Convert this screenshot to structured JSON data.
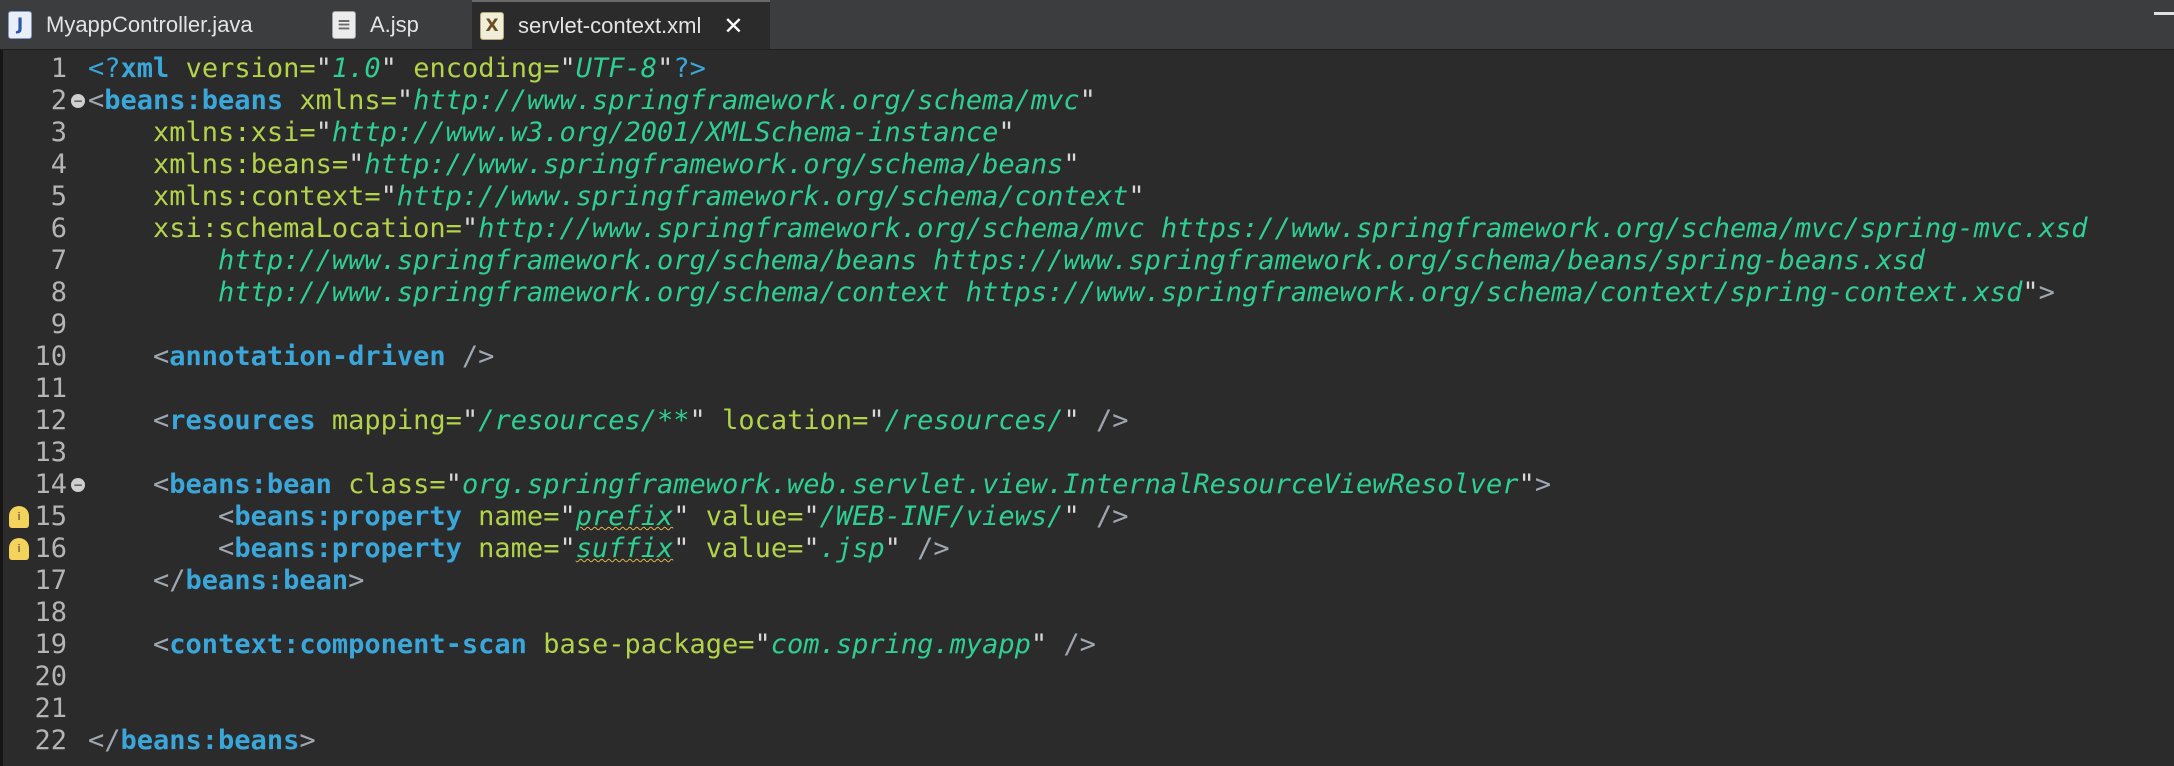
{
  "tabs": [
    {
      "label": "MyappController.java",
      "icon": "java-file-icon",
      "glyph": "J"
    },
    {
      "label": "A.jsp",
      "icon": "jsp-file-icon",
      "glyph": "≡"
    },
    {
      "label": "servlet-context.xml",
      "icon": "xml-file-icon",
      "glyph": "X",
      "active": true,
      "close": "✕"
    }
  ],
  "colors": {
    "tag": "#3aa6d9",
    "attribute": "#b3d34a",
    "value": "#2fcf93",
    "punctuation": "#9ea7b2",
    "line_numbers": "#b4b4b4",
    "background": "#2b2b2b"
  },
  "editor": {
    "fold_lines": [
      2,
      14
    ],
    "warning_lines": [
      15,
      16
    ],
    "lines": [
      {
        "n": "1",
        "tokens": [
          [
            "pi",
            "<?"
          ],
          [
            "tag",
            "xml"
          ],
          [
            "ws",
            " "
          ],
          [
            "attr",
            "version"
          ],
          [
            "eq",
            "="
          ],
          [
            "q",
            "\""
          ],
          [
            "val",
            "1.0"
          ],
          [
            "q",
            "\""
          ],
          [
            "ws",
            " "
          ],
          [
            "attr",
            "encoding"
          ],
          [
            "eq",
            "="
          ],
          [
            "q",
            "\""
          ],
          [
            "val",
            "UTF-8"
          ],
          [
            "q",
            "\""
          ],
          [
            "pi",
            "?>"
          ]
        ]
      },
      {
        "n": "2",
        "tokens": [
          [
            "punct",
            "<"
          ],
          [
            "tag",
            "beans:beans"
          ],
          [
            "ws",
            " "
          ],
          [
            "attr",
            "xmlns"
          ],
          [
            "eq",
            "="
          ],
          [
            "q",
            "\""
          ],
          [
            "val",
            "http://www.springframework.org/schema/mvc"
          ],
          [
            "q",
            "\""
          ]
        ]
      },
      {
        "n": "3",
        "tokens": [
          [
            "ws",
            "    "
          ],
          [
            "attr",
            "xmlns:xsi"
          ],
          [
            "eq",
            "="
          ],
          [
            "q",
            "\""
          ],
          [
            "val",
            "http://www.w3.org/2001/XMLSchema-instance"
          ],
          [
            "q",
            "\""
          ]
        ]
      },
      {
        "n": "4",
        "tokens": [
          [
            "ws",
            "    "
          ],
          [
            "attr",
            "xmlns:beans"
          ],
          [
            "eq",
            "="
          ],
          [
            "q",
            "\""
          ],
          [
            "val",
            "http://www.springframework.org/schema/beans"
          ],
          [
            "q",
            "\""
          ]
        ]
      },
      {
        "n": "5",
        "tokens": [
          [
            "ws",
            "    "
          ],
          [
            "attr",
            "xmlns:context"
          ],
          [
            "eq",
            "="
          ],
          [
            "q",
            "\""
          ],
          [
            "val",
            "http://www.springframework.org/schema/context"
          ],
          [
            "q",
            "\""
          ]
        ]
      },
      {
        "n": "6",
        "tokens": [
          [
            "ws",
            "    "
          ],
          [
            "attr",
            "xsi:schemaLocation"
          ],
          [
            "eq",
            "="
          ],
          [
            "q",
            "\""
          ],
          [
            "val",
            "http://www.springframework.org/schema/mvc https://www.springframework.org/schema/mvc/spring-mvc.xsd"
          ]
        ]
      },
      {
        "n": "7",
        "tokens": [
          [
            "ws",
            "        "
          ],
          [
            "val",
            "http://www.springframework.org/schema/beans https://www.springframework.org/schema/beans/spring-beans.xsd"
          ]
        ]
      },
      {
        "n": "8",
        "tokens": [
          [
            "ws",
            "        "
          ],
          [
            "val",
            "http://www.springframework.org/schema/context https://www.springframework.org/schema/context/spring-context.xsd"
          ],
          [
            "q",
            "\""
          ],
          [
            "punct",
            ">"
          ]
        ]
      },
      {
        "n": "9",
        "tokens": []
      },
      {
        "n": "10",
        "tokens": [
          [
            "ws",
            "    "
          ],
          [
            "punct",
            "<"
          ],
          [
            "tag",
            "annotation-driven"
          ],
          [
            "ws",
            " "
          ],
          [
            "punct",
            "/>"
          ]
        ]
      },
      {
        "n": "11",
        "tokens": []
      },
      {
        "n": "12",
        "tokens": [
          [
            "ws",
            "    "
          ],
          [
            "punct",
            "<"
          ],
          [
            "tag",
            "resources"
          ],
          [
            "ws",
            " "
          ],
          [
            "attr",
            "mapping"
          ],
          [
            "eq",
            "="
          ],
          [
            "q",
            "\""
          ],
          [
            "val",
            "/resources/**"
          ],
          [
            "q",
            "\""
          ],
          [
            "ws",
            " "
          ],
          [
            "attr",
            "location"
          ],
          [
            "eq",
            "="
          ],
          [
            "q",
            "\""
          ],
          [
            "val",
            "/resources/"
          ],
          [
            "q",
            "\""
          ],
          [
            "ws",
            " "
          ],
          [
            "punct",
            "/>"
          ]
        ]
      },
      {
        "n": "13",
        "tokens": []
      },
      {
        "n": "14",
        "tokens": [
          [
            "ws",
            "    "
          ],
          [
            "punct",
            "<"
          ],
          [
            "tag",
            "beans:bean"
          ],
          [
            "ws",
            " "
          ],
          [
            "attr",
            "class"
          ],
          [
            "eq",
            "="
          ],
          [
            "q",
            "\""
          ],
          [
            "val",
            "org.springframework.web.servlet.view.InternalResourceViewResolver"
          ],
          [
            "q",
            "\""
          ],
          [
            "punct",
            ">"
          ]
        ]
      },
      {
        "n": "15",
        "tokens": [
          [
            "ws",
            "        "
          ],
          [
            "punct",
            "<"
          ],
          [
            "tag",
            "beans:property"
          ],
          [
            "ws",
            " "
          ],
          [
            "attr",
            "name"
          ],
          [
            "eq",
            "="
          ],
          [
            "q",
            "\""
          ],
          [
            "valsq",
            "prefix"
          ],
          [
            "q",
            "\""
          ],
          [
            "ws",
            " "
          ],
          [
            "attr",
            "value"
          ],
          [
            "eq",
            "="
          ],
          [
            "q",
            "\""
          ],
          [
            "val",
            "/WEB-INF/views/"
          ],
          [
            "q",
            "\""
          ],
          [
            "ws",
            " "
          ],
          [
            "punct",
            "/>"
          ]
        ]
      },
      {
        "n": "16",
        "tokens": [
          [
            "ws",
            "        "
          ],
          [
            "punct",
            "<"
          ],
          [
            "tag",
            "beans:property"
          ],
          [
            "ws",
            " "
          ],
          [
            "attr",
            "name"
          ],
          [
            "eq",
            "="
          ],
          [
            "q",
            "\""
          ],
          [
            "valsq",
            "suffix"
          ],
          [
            "q",
            "\""
          ],
          [
            "ws",
            " "
          ],
          [
            "attr",
            "value"
          ],
          [
            "eq",
            "="
          ],
          [
            "q",
            "\""
          ],
          [
            "val",
            ".jsp"
          ],
          [
            "q",
            "\""
          ],
          [
            "ws",
            " "
          ],
          [
            "punct",
            "/>"
          ]
        ]
      },
      {
        "n": "17",
        "tokens": [
          [
            "ws",
            "    "
          ],
          [
            "punct",
            "</"
          ],
          [
            "tag",
            "beans:bean"
          ],
          [
            "punct",
            ">"
          ]
        ]
      },
      {
        "n": "18",
        "tokens": []
      },
      {
        "n": "19",
        "tokens": [
          [
            "ws",
            "    "
          ],
          [
            "punct",
            "<"
          ],
          [
            "tag",
            "context:component-scan"
          ],
          [
            "ws",
            " "
          ],
          [
            "attr",
            "base-package"
          ],
          [
            "eq",
            "="
          ],
          [
            "q",
            "\""
          ],
          [
            "val",
            "com.spring.myapp"
          ],
          [
            "q",
            "\""
          ],
          [
            "ws",
            " "
          ],
          [
            "punct",
            "/>"
          ]
        ]
      },
      {
        "n": "20",
        "tokens": []
      },
      {
        "n": "21",
        "tokens": []
      },
      {
        "n": "22",
        "tokens": [
          [
            "punct",
            "</"
          ],
          [
            "tag",
            "beans:beans"
          ],
          [
            "punct",
            ">"
          ]
        ]
      }
    ]
  }
}
